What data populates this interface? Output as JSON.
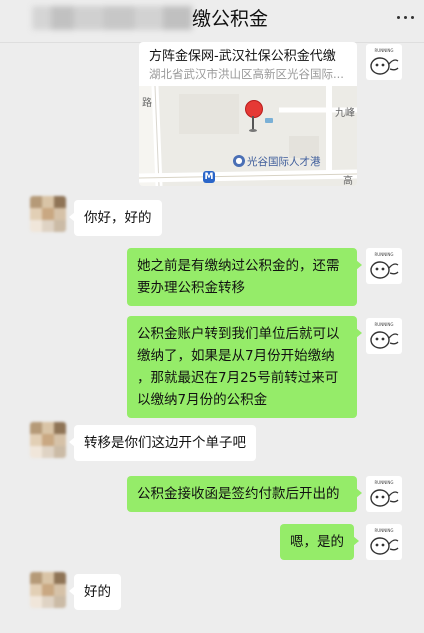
{
  "header": {
    "title": "缴公积金"
  },
  "map_card": {
    "title": "方阵金保网-武汉社保公积金代缴",
    "address": "湖北省武汉市洪山区高新区光谷国际...",
    "map_labels": {
      "road_left": "路",
      "road_top_right": "九峰",
      "poi": "光谷国际人才港",
      "metro": "M",
      "road_bottom_right": "高"
    }
  },
  "messages": [
    {
      "sender": "other",
      "text": "你好，好的"
    },
    {
      "sender": "me",
      "lines": [
        "她之前是有缴纳过公积金的，还需",
        "要办理公积金转移"
      ]
    },
    {
      "sender": "me",
      "lines": [
        "公积金账户转到我们单位后就可以",
        "缴纳了，如果是从7月份开始缴纳",
        "，那就最迟在7月25号前转过来可",
        "以缴纳7月份的公积金"
      ]
    },
    {
      "sender": "other",
      "text": "转移是你们这边开个单子吧"
    },
    {
      "sender": "me",
      "text": "公积金接收函是签约付款后开出的"
    },
    {
      "sender": "me",
      "text": "嗯，是的"
    },
    {
      "sender": "other",
      "text": "好的"
    }
  ],
  "avatar_me": {
    "caption": "RUNNING"
  },
  "colors": {
    "chat_bg": "#ededed",
    "bubble_me": "#95ec69",
    "bubble_other": "#ffffff",
    "pin": "#e53935"
  }
}
